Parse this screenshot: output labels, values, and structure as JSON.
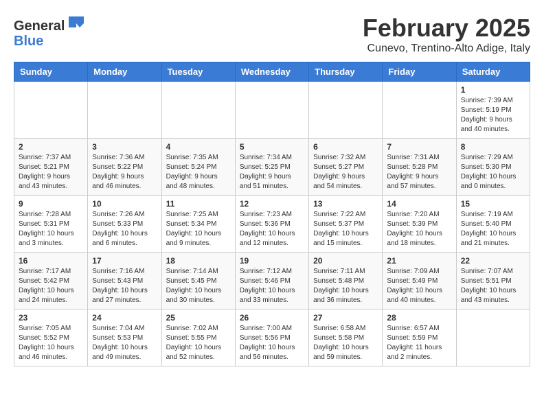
{
  "header": {
    "logo_line1": "General",
    "logo_line2": "Blue",
    "month_title": "February 2025",
    "location": "Cunevo, Trentino-Alto Adige, Italy"
  },
  "days_of_week": [
    "Sunday",
    "Monday",
    "Tuesday",
    "Wednesday",
    "Thursday",
    "Friday",
    "Saturday"
  ],
  "weeks": [
    [
      {
        "num": "",
        "info": ""
      },
      {
        "num": "",
        "info": ""
      },
      {
        "num": "",
        "info": ""
      },
      {
        "num": "",
        "info": ""
      },
      {
        "num": "",
        "info": ""
      },
      {
        "num": "",
        "info": ""
      },
      {
        "num": "1",
        "info": "Sunrise: 7:39 AM\nSunset: 5:19 PM\nDaylight: 9 hours\nand 40 minutes."
      }
    ],
    [
      {
        "num": "2",
        "info": "Sunrise: 7:37 AM\nSunset: 5:21 PM\nDaylight: 9 hours\nand 43 minutes."
      },
      {
        "num": "3",
        "info": "Sunrise: 7:36 AM\nSunset: 5:22 PM\nDaylight: 9 hours\nand 46 minutes."
      },
      {
        "num": "4",
        "info": "Sunrise: 7:35 AM\nSunset: 5:24 PM\nDaylight: 9 hours\nand 48 minutes."
      },
      {
        "num": "5",
        "info": "Sunrise: 7:34 AM\nSunset: 5:25 PM\nDaylight: 9 hours\nand 51 minutes."
      },
      {
        "num": "6",
        "info": "Sunrise: 7:32 AM\nSunset: 5:27 PM\nDaylight: 9 hours\nand 54 minutes."
      },
      {
        "num": "7",
        "info": "Sunrise: 7:31 AM\nSunset: 5:28 PM\nDaylight: 9 hours\nand 57 minutes."
      },
      {
        "num": "8",
        "info": "Sunrise: 7:29 AM\nSunset: 5:30 PM\nDaylight: 10 hours\nand 0 minutes."
      }
    ],
    [
      {
        "num": "9",
        "info": "Sunrise: 7:28 AM\nSunset: 5:31 PM\nDaylight: 10 hours\nand 3 minutes."
      },
      {
        "num": "10",
        "info": "Sunrise: 7:26 AM\nSunset: 5:33 PM\nDaylight: 10 hours\nand 6 minutes."
      },
      {
        "num": "11",
        "info": "Sunrise: 7:25 AM\nSunset: 5:34 PM\nDaylight: 10 hours\nand 9 minutes."
      },
      {
        "num": "12",
        "info": "Sunrise: 7:23 AM\nSunset: 5:36 PM\nDaylight: 10 hours\nand 12 minutes."
      },
      {
        "num": "13",
        "info": "Sunrise: 7:22 AM\nSunset: 5:37 PM\nDaylight: 10 hours\nand 15 minutes."
      },
      {
        "num": "14",
        "info": "Sunrise: 7:20 AM\nSunset: 5:39 PM\nDaylight: 10 hours\nand 18 minutes."
      },
      {
        "num": "15",
        "info": "Sunrise: 7:19 AM\nSunset: 5:40 PM\nDaylight: 10 hours\nand 21 minutes."
      }
    ],
    [
      {
        "num": "16",
        "info": "Sunrise: 7:17 AM\nSunset: 5:42 PM\nDaylight: 10 hours\nand 24 minutes."
      },
      {
        "num": "17",
        "info": "Sunrise: 7:16 AM\nSunset: 5:43 PM\nDaylight: 10 hours\nand 27 minutes."
      },
      {
        "num": "18",
        "info": "Sunrise: 7:14 AM\nSunset: 5:45 PM\nDaylight: 10 hours\nand 30 minutes."
      },
      {
        "num": "19",
        "info": "Sunrise: 7:12 AM\nSunset: 5:46 PM\nDaylight: 10 hours\nand 33 minutes."
      },
      {
        "num": "20",
        "info": "Sunrise: 7:11 AM\nSunset: 5:48 PM\nDaylight: 10 hours\nand 36 minutes."
      },
      {
        "num": "21",
        "info": "Sunrise: 7:09 AM\nSunset: 5:49 PM\nDaylight: 10 hours\nand 40 minutes."
      },
      {
        "num": "22",
        "info": "Sunrise: 7:07 AM\nSunset: 5:51 PM\nDaylight: 10 hours\nand 43 minutes."
      }
    ],
    [
      {
        "num": "23",
        "info": "Sunrise: 7:05 AM\nSunset: 5:52 PM\nDaylight: 10 hours\nand 46 minutes."
      },
      {
        "num": "24",
        "info": "Sunrise: 7:04 AM\nSunset: 5:53 PM\nDaylight: 10 hours\nand 49 minutes."
      },
      {
        "num": "25",
        "info": "Sunrise: 7:02 AM\nSunset: 5:55 PM\nDaylight: 10 hours\nand 52 minutes."
      },
      {
        "num": "26",
        "info": "Sunrise: 7:00 AM\nSunset: 5:56 PM\nDaylight: 10 hours\nand 56 minutes."
      },
      {
        "num": "27",
        "info": "Sunrise: 6:58 AM\nSunset: 5:58 PM\nDaylight: 10 hours\nand 59 minutes."
      },
      {
        "num": "28",
        "info": "Sunrise: 6:57 AM\nSunset: 5:59 PM\nDaylight: 11 hours\nand 2 minutes."
      },
      {
        "num": "",
        "info": ""
      }
    ]
  ]
}
